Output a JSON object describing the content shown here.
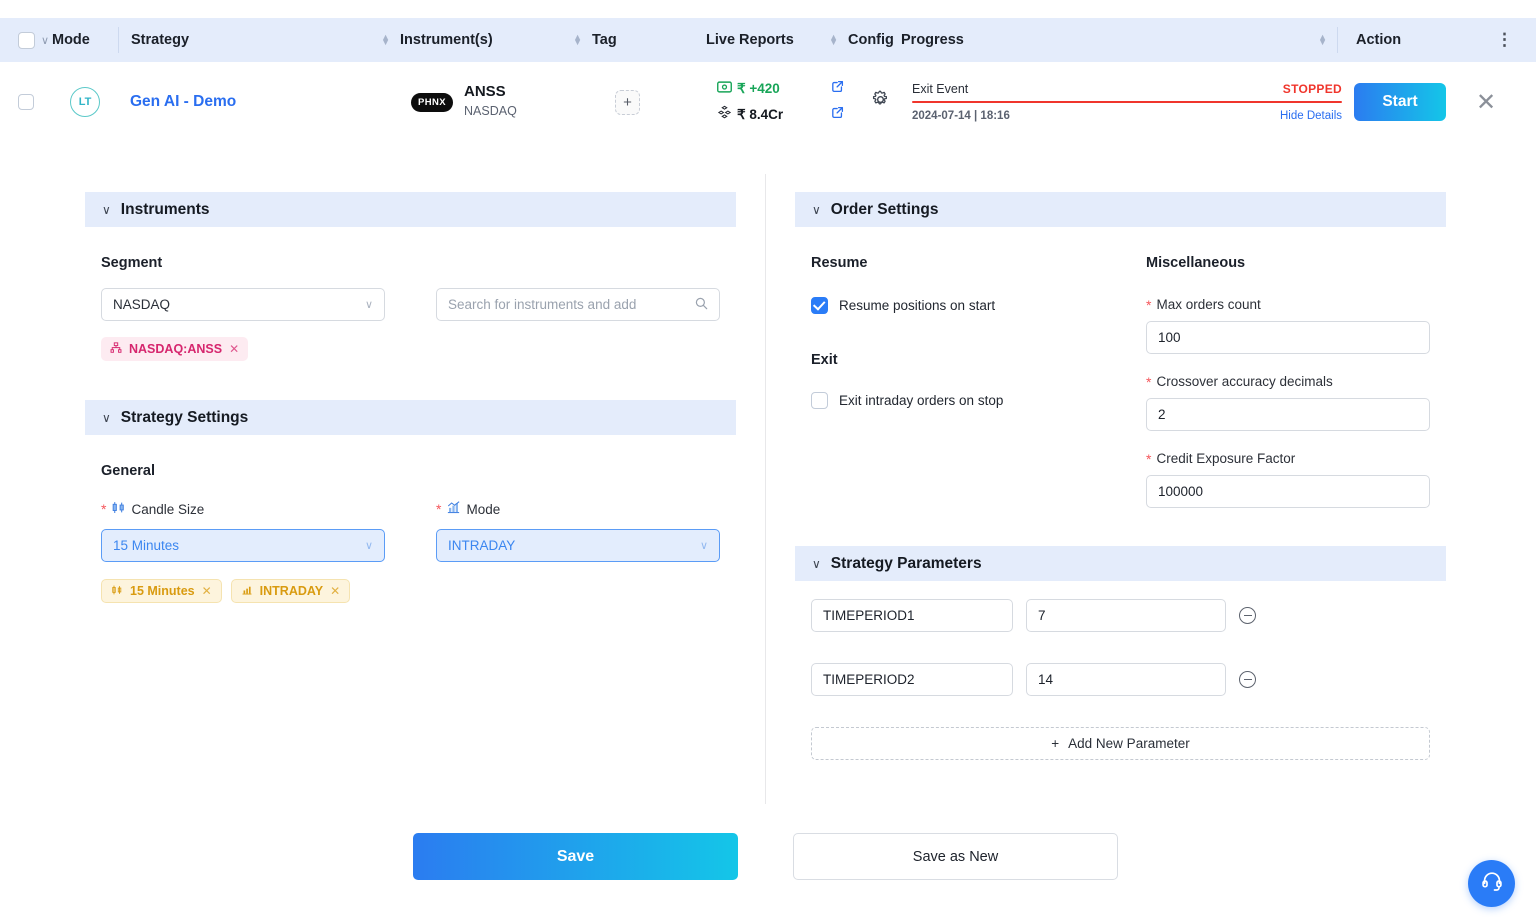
{
  "table_header": {
    "columns": [
      {
        "label": "Mode",
        "sortable": false
      },
      {
        "label": "Strategy",
        "sortable": true
      },
      {
        "label": "Instrument(s)",
        "sortable": true
      },
      {
        "label": "Tag",
        "sortable": false
      },
      {
        "label": "Live Reports",
        "sortable": true
      },
      {
        "label": "Config",
        "sortable": false
      },
      {
        "label": "Progress",
        "sortable": true
      },
      {
        "label": "Action",
        "sortable": false
      }
    ],
    "kebab_icon": "more-vertical-icon"
  },
  "row": {
    "mode_avatar": "LT",
    "strategy_name": "Gen AI - Demo",
    "instrument_badge": "PHNX",
    "instrument_symbol": "ANSS",
    "instrument_exchange": "NASDAQ",
    "tag_add_label": "+",
    "live_reports": [
      {
        "icon": "banknote-icon",
        "value": "₹ +420",
        "tone": "green"
      },
      {
        "icon": "cubes-icon",
        "value": "₹ 8.4Cr",
        "tone": "dark"
      }
    ],
    "config_icon": "gear-icon",
    "progress": {
      "event": "Exit Event",
      "status": "STOPPED",
      "status_color": "#f0352c",
      "timestamp": "2024-07-14 | 18:16",
      "details_toggle": "Hide Details"
    },
    "action_button": "Start",
    "close_icon": "close-icon"
  },
  "instruments": {
    "section_title": "Instruments",
    "segment_label": "Segment",
    "segment_value": "NASDAQ",
    "search_placeholder": "Search for instruments and add",
    "chips": [
      {
        "icon": "instrument-icon",
        "label": "NASDAQ:ANSS"
      }
    ]
  },
  "strategy_settings": {
    "section_title": "Strategy Settings",
    "group_label": "General",
    "candle_size": {
      "label": "Candle Size",
      "icon": "candlestick-icon",
      "required": true,
      "value": "15 Minutes"
    },
    "mode": {
      "label": "Mode",
      "icon": "bar-chart-icon",
      "required": true,
      "value": "INTRADAY"
    },
    "chips": [
      {
        "icon": "candlestick-icon",
        "label": "15 Minutes"
      },
      {
        "icon": "bar-chart-icon",
        "label": "INTRADAY"
      }
    ]
  },
  "order_settings": {
    "section_title": "Order Settings",
    "resume_label": "Resume",
    "resume_checkbox": {
      "label": "Resume positions on start",
      "checked": true
    },
    "exit_label": "Exit",
    "exit_checkbox": {
      "label": "Exit intraday orders on stop",
      "checked": false
    },
    "misc_label": "Miscellaneous",
    "fields": [
      {
        "label": "Max orders count",
        "value": "100",
        "required": true
      },
      {
        "label": "Crossover accuracy decimals",
        "value": "2",
        "required": true
      },
      {
        "label": "Credit Exposure Factor",
        "value": "100000",
        "required": true
      }
    ]
  },
  "strategy_parameters": {
    "section_title": "Strategy Parameters",
    "params": [
      {
        "name": "TIMEPERIOD1",
        "value": "7"
      },
      {
        "name": "TIMEPERIOD2",
        "value": "14"
      }
    ],
    "add_label": "Add New Parameter"
  },
  "footer": {
    "save_label": "Save",
    "save_as_new_label": "Save as New",
    "support_icon": "headset-icon"
  },
  "colors": {
    "accent": "#2a6ef0",
    "section_header_bg": "#e4ecfb",
    "danger": "#f0352c",
    "success": "#18a558",
    "chip_pink": "#d6266e",
    "chip_yellow": "#d99b10"
  }
}
